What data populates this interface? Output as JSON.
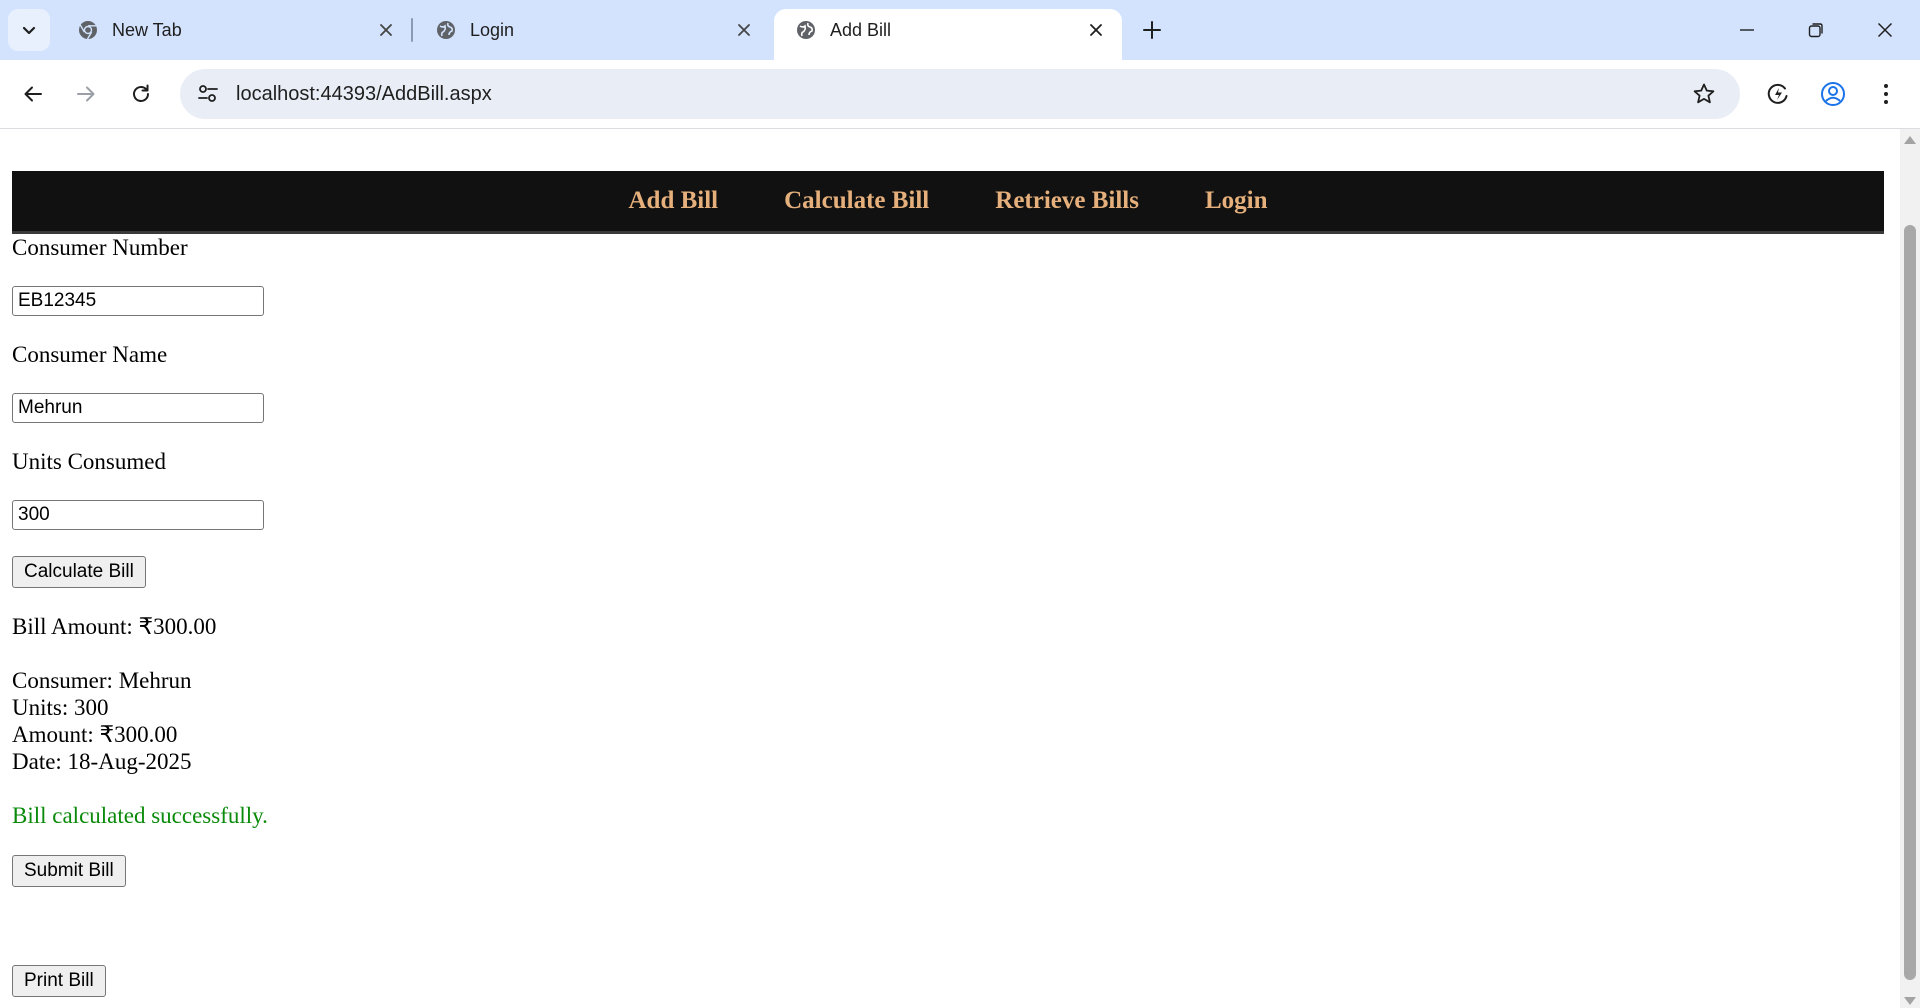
{
  "browser": {
    "tabs": [
      {
        "title": "New Tab",
        "icon": "chrome-icon"
      },
      {
        "title": "Login",
        "icon": "globe-icon"
      },
      {
        "title": "Add Bill",
        "icon": "globe-icon",
        "active": true
      }
    ],
    "url": "localhost:44393/AddBill.aspx"
  },
  "nav": {
    "items": [
      "Add Bill",
      "Calculate Bill",
      "Retrieve Bills",
      "Login"
    ],
    "link_color": "#e6b07c",
    "background": "#111111"
  },
  "form": {
    "consumer_number_label": "Consumer Number",
    "consumer_number_value": "EB12345",
    "consumer_name_label": "Consumer Name",
    "consumer_name_value": "Mehrun",
    "units_label": "Units Consumed",
    "units_value": "300",
    "calculate_button": "Calculate Bill"
  },
  "result": {
    "bill_amount": "Bill Amount: ₹300.00",
    "consumer": "Consumer: Mehrun",
    "units": "Units: 300",
    "amount": "Amount: ₹300.00",
    "date": "Date: 18-Aug-2025",
    "message": "Bill calculated successfully.",
    "message_color": "#0a8a0a"
  },
  "actions": {
    "submit_button": "Submit Bill",
    "print_button": "Print Bill"
  }
}
